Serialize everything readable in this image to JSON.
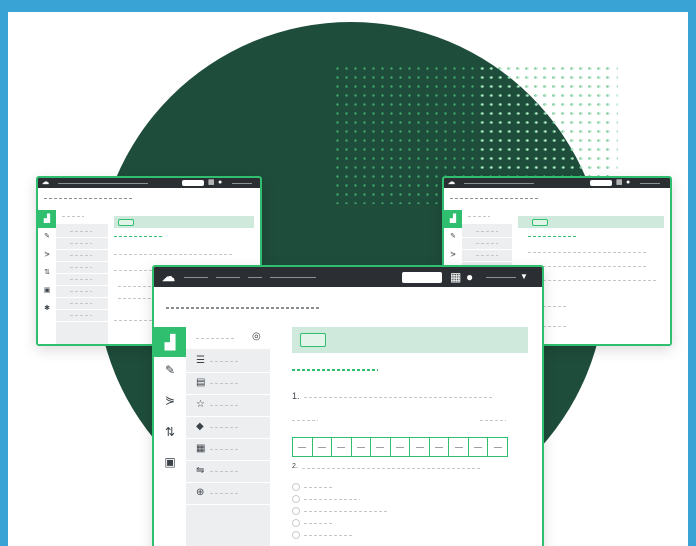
{
  "app": {
    "brand_color": "#2fbf6f",
    "topbar_color": "#2b2f33",
    "frame_color": "#3aa3d6",
    "circle_color": "#1f4d3b"
  },
  "icons": {
    "logo": "cloud-logo-icon",
    "grid": "grid-icon",
    "help": "help-icon",
    "caret": "chevron-down-icon",
    "sidebar": [
      "chart-icon",
      "brush-icon",
      "flow-icon",
      "sliders-icon",
      "calendar-icon",
      "gear-icon"
    ],
    "panel": [
      "list-icon",
      "image-icon",
      "star-icon",
      "globe-icon",
      "table-icon",
      "matrix-icon",
      "lock-icon"
    ]
  },
  "main_window": {
    "question_number_1": "1.",
    "question_number_2": "2."
  }
}
